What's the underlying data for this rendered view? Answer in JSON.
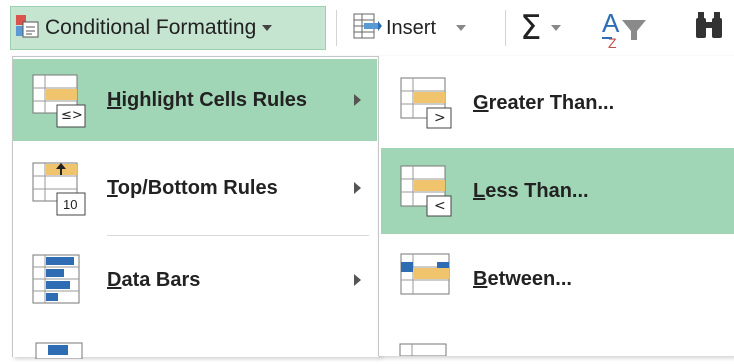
{
  "ribbon": {
    "conditional_formatting": "Conditional Formatting",
    "insert": "Insert",
    "sum_symbol": "Σ"
  },
  "main_menu": {
    "items": [
      {
        "label_accel": "H",
        "label_rest": "ighlight Cells Rules",
        "icon": "highlight-cells-rules-icon",
        "active": true
      },
      {
        "label_accel": "T",
        "label_rest": "op/Bottom Rules",
        "icon": "top-bottom-rules-icon",
        "active": false
      },
      {
        "label_accel": "D",
        "label_rest": "ata Bars",
        "icon": "data-bars-icon",
        "active": false
      }
    ]
  },
  "sub_menu": {
    "items": [
      {
        "label_accel": "G",
        "label_rest": "reater Than...",
        "icon": "greater-than-icon",
        "active": false
      },
      {
        "label_accel": "L",
        "label_rest": "ess Than...",
        "icon": "less-than-icon",
        "active": true
      },
      {
        "label_accel": "B",
        "label_rest": "etween...",
        "icon": "between-icon",
        "active": false
      }
    ]
  },
  "icon_badges": {
    "highlight": "≤>",
    "topbottom": "10",
    "greater": ">",
    "less": "<"
  },
  "colors": {
    "active_bg": "#a0d6b5",
    "ribbon_active_bg": "#c6e5d1",
    "cell_highlight": "#f0c36d",
    "data_bar_blue": "#2e6db4"
  }
}
